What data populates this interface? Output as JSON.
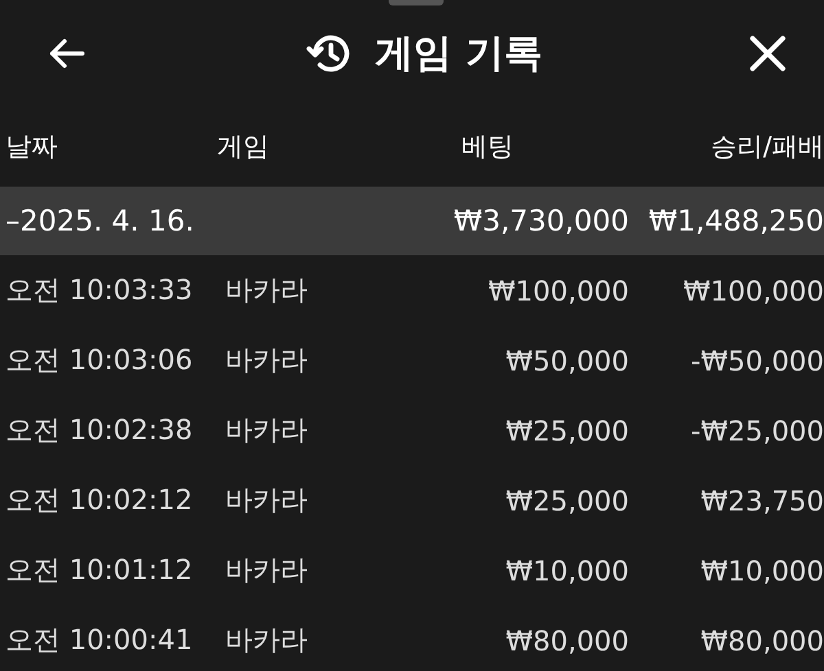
{
  "header": {
    "title": "게임 기록"
  },
  "table": {
    "columns": [
      "날짜",
      "게임",
      "베팅",
      "승리/패배"
    ],
    "groups": [
      {
        "label": "–2025. 4. 16.",
        "bet": "₩3,730,000",
        "result": "₩1,488,250",
        "selected": true,
        "rows": [
          {
            "time": "오전 10:03:33",
            "game": "바카라",
            "bet": "₩100,000",
            "result": "₩100,000"
          },
          {
            "time": "오전 10:03:06",
            "game": "바카라",
            "bet": "₩50,000",
            "result": "-₩50,000"
          },
          {
            "time": "오전 10:02:38",
            "game": "바카라",
            "bet": "₩25,000",
            "result": "-₩25,000"
          },
          {
            "time": "오전 10:02:12",
            "game": "바카라",
            "bet": "₩25,000",
            "result": "₩23,750"
          },
          {
            "time": "오전 10:01:12",
            "game": "바카라",
            "bet": "₩10,000",
            "result": "₩10,000"
          },
          {
            "time": "오전 10:00:41",
            "game": "바카라",
            "bet": "₩80,000",
            "result": "₩80,000"
          }
        ]
      }
    ]
  }
}
